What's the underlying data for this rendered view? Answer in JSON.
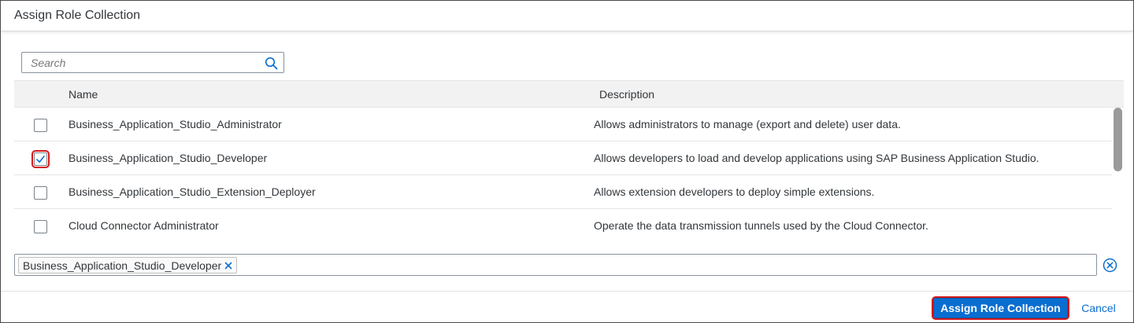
{
  "dialog": {
    "title": "Assign Role Collection"
  },
  "search": {
    "placeholder": "Search",
    "value": ""
  },
  "table": {
    "columns": {
      "name": "Name",
      "description": "Description"
    },
    "rows": [
      {
        "name": "Business_Application_Studio_Administrator",
        "description": "Allows administrators to manage (export and delete) user data.",
        "checked": false
      },
      {
        "name": "Business_Application_Studio_Developer",
        "description": "Allows developers to load and develop applications using SAP Business Application Studio.",
        "checked": true
      },
      {
        "name": "Business_Application_Studio_Extension_Deployer",
        "description": "Allows extension developers to deploy simple extensions.",
        "checked": false
      },
      {
        "name": "Cloud Connector Administrator",
        "description": "Operate the data transmission tunnels used by the Cloud Connector.",
        "checked": false
      }
    ]
  },
  "tokens": [
    {
      "label": "Business_Application_Studio_Developer"
    }
  ],
  "footer": {
    "assign_label": "Assign Role Collection",
    "cancel_label": "Cancel"
  },
  "colors": {
    "accent": "#0a6ed1",
    "highlight": "#d3191c",
    "text": "#32363a",
    "header_bg": "#f2f2f2"
  },
  "icons": {
    "search": "search-icon",
    "checkmark": "checkmark-icon",
    "token_remove": "close-icon",
    "clear_all": "clear-circle-icon"
  }
}
